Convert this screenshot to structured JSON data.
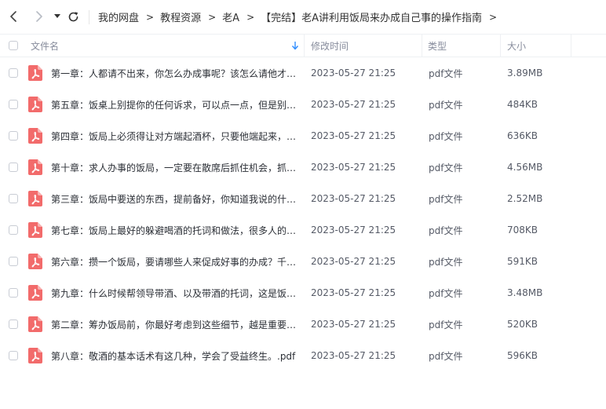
{
  "breadcrumb": {
    "items": [
      "我的网盘",
      "教程资源",
      "老A",
      "【完结】老A讲利用饭局来办成自己事的操作指南"
    ],
    "separator": ">"
  },
  "header": {
    "name_label": "文件名",
    "modified_label": "修改时间",
    "type_label": "类型",
    "size_label": "大小"
  },
  "colors": {
    "pdf_icon": "#f26b6b",
    "sort_arrow": "#2f8dff"
  },
  "files": [
    {
      "name": "第一章：人都请不出来，你怎么办成事呢？该怎么请他才…",
      "modified": "2023-05-27 21:25",
      "type": "pdf文件",
      "size": "3.89MB"
    },
    {
      "name": "第五章：饭桌上别提你的任何诉求，可以点一点，但是别…",
      "modified": "2023-05-27 21:25",
      "type": "pdf文件",
      "size": "484KB"
    },
    {
      "name": "第四章：饭局上必须得让对方端起酒杯，只要他端起来，…",
      "modified": "2023-05-27 21:25",
      "type": "pdf文件",
      "size": "636KB"
    },
    {
      "name": "第十章：求人办事的饭局，一定要在散席后抓住机会，抓…",
      "modified": "2023-05-27 21:25",
      "type": "pdf文件",
      "size": "4.56MB"
    },
    {
      "name": "第三章：饭局中要送的东西，提前备好，你知道我说的什…",
      "modified": "2023-05-27 21:25",
      "type": "pdf文件",
      "size": "2.52MB"
    },
    {
      "name": "第七章：饭局上最好的躲避喝酒的托词和做法，很多人的…",
      "modified": "2023-05-27 21:25",
      "type": "pdf文件",
      "size": "708KB"
    },
    {
      "name": "第六章：攒一个饭局，要请哪些人来促成好事的办成？千…",
      "modified": "2023-05-27 21:25",
      "type": "pdf文件",
      "size": "591KB"
    },
    {
      "name": "第九章：什么时候帮领导带酒、以及带酒的托词，这是饭…",
      "modified": "2023-05-27 21:25",
      "type": "pdf文件",
      "size": "3.48MB"
    },
    {
      "name": "第二章：筹办饭局前，你最好考虑到这些细节，越是重要…",
      "modified": "2023-05-27 21:25",
      "type": "pdf文件",
      "size": "520KB"
    },
    {
      "name": "第八章：敬酒的基本话术有这几种，学会了受益终生。.pdf",
      "modified": "2023-05-27 21:25",
      "type": "pdf文件",
      "size": "596KB"
    }
  ]
}
